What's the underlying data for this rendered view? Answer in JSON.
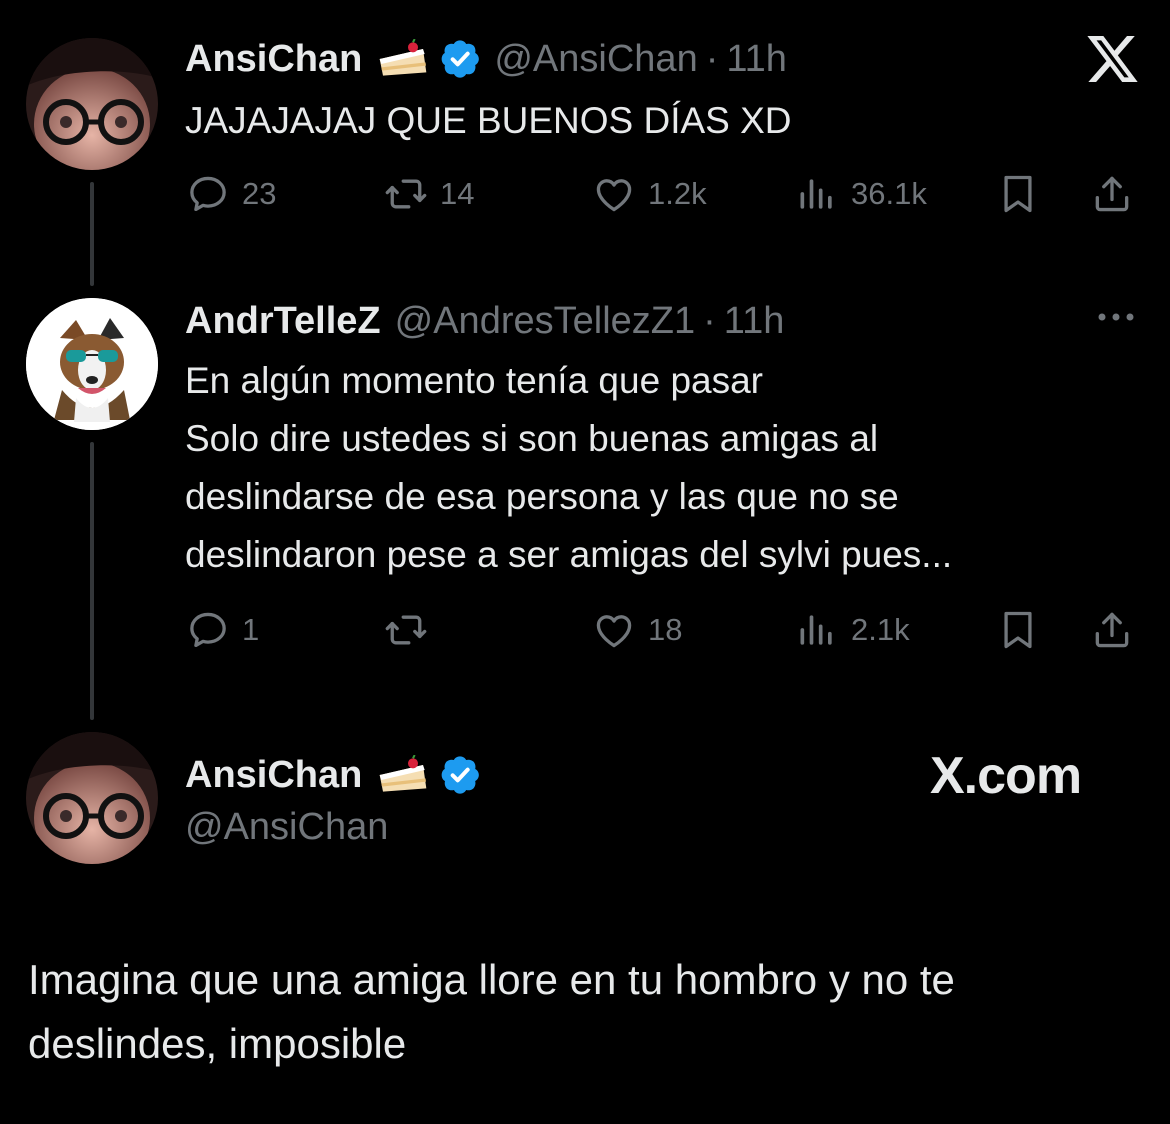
{
  "colors": {
    "background": "#000000",
    "text": "#e7e9ea",
    "muted": "#71767b",
    "verified": "#1d9bf0",
    "thread_line": "#333639"
  },
  "tweet1": {
    "name": "AnsiChan",
    "handle": "@AnsiChan",
    "dot": "·",
    "time": "11h",
    "text": "JAJAJAJAJ QUE BUENOS DÍAS XD",
    "actions": {
      "replies": "23",
      "retweets": "14",
      "likes": "1.2k",
      "views": "36.1k"
    },
    "icons": [
      "reply-icon",
      "retweet-icon",
      "like-icon",
      "views-icon",
      "bookmark-icon",
      "share-icon"
    ]
  },
  "top_right_icon": "x-logo-icon",
  "tweet2": {
    "name": "AndrTelleZ",
    "handle": "@AndresTellezZ1",
    "dot": "·",
    "time": "11h",
    "lines": [
      "En algún momento tenía que pasar",
      "Solo dire ustedes si son buenas amigas al",
      "deslindarse de esa persona y las que no se",
      "deslindaron pese a ser amigas del sylvi pues..."
    ],
    "actions": {
      "replies": "1",
      "retweets": "",
      "likes": "18",
      "views": "2.1k"
    },
    "more_icon": "more-icon"
  },
  "tweet3": {
    "name": "AnsiChan",
    "handle": "@AnsiChan",
    "watermark": "X.com",
    "lines": [
      "Imagina que una amiga llore en tu hombro y no te",
      "deslindes, imposible"
    ]
  }
}
